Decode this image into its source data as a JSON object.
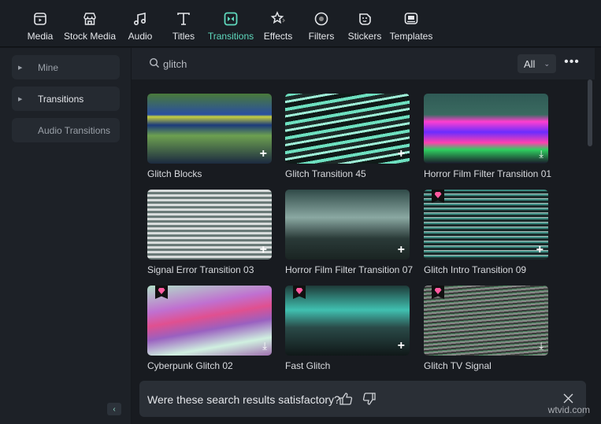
{
  "toolbar": {
    "items": [
      {
        "label": "Media",
        "icon": "media-icon"
      },
      {
        "label": "Stock Media",
        "icon": "store-icon"
      },
      {
        "label": "Audio",
        "icon": "music-note-icon"
      },
      {
        "label": "Titles",
        "icon": "text-t-icon"
      },
      {
        "label": "Transitions",
        "icon": "transition-icon",
        "active": true
      },
      {
        "label": "Effects",
        "icon": "sparkle-star-icon"
      },
      {
        "label": "Filters",
        "icon": "filter-circle-icon"
      },
      {
        "label": "Stickers",
        "icon": "sticker-icon"
      },
      {
        "label": "Templates",
        "icon": "template-icon"
      }
    ]
  },
  "sidebar": {
    "items": [
      {
        "label": "Mine",
        "expandable": true
      },
      {
        "label": "Transitions",
        "expandable": true,
        "selected": true
      },
      {
        "label": "Audio Transitions",
        "expandable": false
      }
    ]
  },
  "search": {
    "value": "glitch",
    "filter": "All"
  },
  "results": [
    {
      "name": "Glitch Blocks",
      "premium": false,
      "action": "add"
    },
    {
      "name": "Glitch Transition 45",
      "premium": false,
      "action": "add"
    },
    {
      "name": "Horror Film Filter Transition 01",
      "premium": false,
      "action": "download"
    },
    {
      "name": "Signal Error Transition 03",
      "premium": false,
      "action": "add"
    },
    {
      "name": "Horror Film Filter Transition 07",
      "premium": false,
      "action": "add"
    },
    {
      "name": "Glitch Intro Transition 09",
      "premium": true,
      "action": "add"
    },
    {
      "name": "Cyberpunk Glitch 02",
      "premium": true,
      "action": "download"
    },
    {
      "name": "Fast Glitch",
      "premium": true,
      "action": "add"
    },
    {
      "name": "Glitch TV Signal",
      "premium": true,
      "action": "download"
    }
  ],
  "feedback": {
    "question": "Were these search results satisfactory?"
  },
  "watermark": "wtvid.com",
  "colors": {
    "accent": "#5fd9bd",
    "premium": "#ff5aa0"
  }
}
